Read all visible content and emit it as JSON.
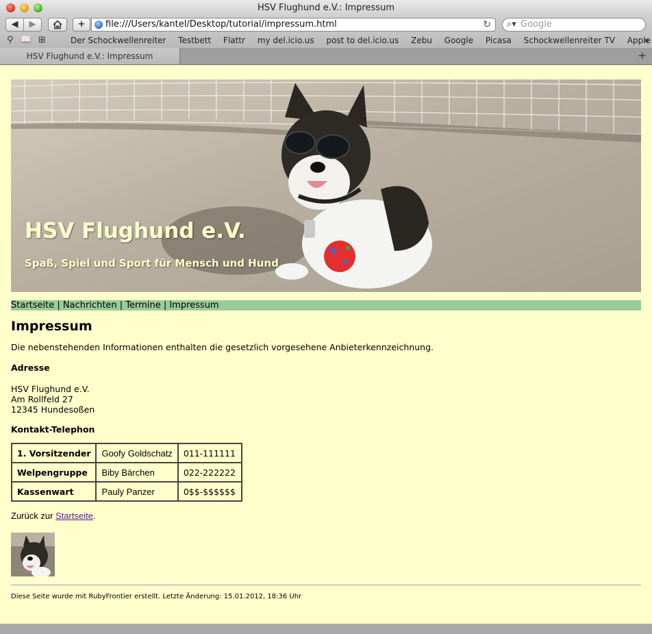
{
  "window": {
    "title": "HSV Flughund e.V.: Impressum"
  },
  "toolbar": {
    "back_symbol": "◀",
    "forward_symbol": "▶",
    "url": "file:///Users/kantel/Desktop/tutorial/impressum.html",
    "search_placeholder": "Google"
  },
  "bookmarks": {
    "items": [
      "Der Schockwellenreiter",
      "Testbett",
      "Flattr",
      "my del.icio.us",
      "post to del.icio.us",
      "Zebu",
      "Google",
      "Picasa",
      "Schockwellenreiter TV",
      "Apple ▾"
    ],
    "more": "»"
  },
  "tabs": [
    {
      "label": "HSV Flughund e.V.: Impressum"
    }
  ],
  "banner": {
    "title": "HSV Flughund e.V.",
    "subtitle": "Spaß, Spiel und Sport für Mensch und Hund"
  },
  "nav": {
    "links": [
      "Startseite",
      "Nachrichten",
      "Termine",
      "Impressum"
    ],
    "separator": " | "
  },
  "content": {
    "heading": "Impressum",
    "intro": "Die nebenstehenden Informationen enthalten die gesetzlich vorgesehene Anbieterkennzeichnung.",
    "address_heading": "Adresse",
    "address_lines": [
      "HSV Flughund e.V.",
      "Am Rollfeld 27",
      "12345 Hundesoßen"
    ],
    "contact_heading": "Kontakt-Telephon",
    "contacts": [
      {
        "role": "1. Vorsitzender",
        "name": "Goofy Goldschatz",
        "phone": "011-111111"
      },
      {
        "role": "Welpengruppe",
        "name": "Biby Bärchen",
        "phone": "022-222222"
      },
      {
        "role": "Kassenwart",
        "name": "Pauly Panzer",
        "phone": "0$$-$$$$$$"
      }
    ],
    "back_prefix": "Zurück zur ",
    "back_link": "Startseite",
    "back_suffix": "."
  },
  "footer": {
    "text": "Diese Seite wurde mit RubyFrontier erstellt. Letzte Änderung: 15.01.2012, 18:36 Uhr"
  },
  "colors": {
    "page_bg": "#ffffcc",
    "nav_bg": "#99cc99",
    "banner_text": "#ffffcc",
    "link_visited": "#551a8b"
  }
}
